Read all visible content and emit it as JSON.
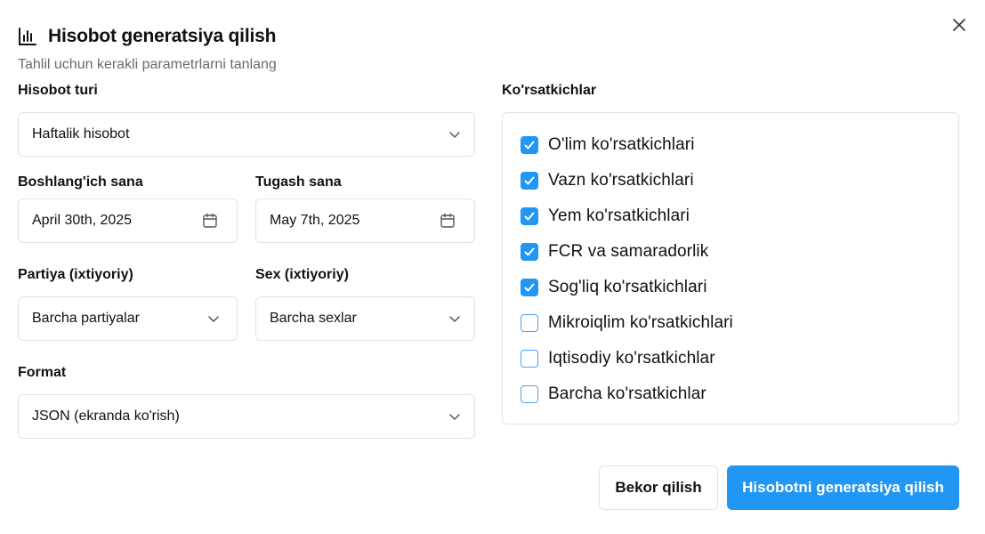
{
  "dialog": {
    "title": "Hisobot generatsiya qilish",
    "subtitle": "Tahlil uchun kerakli parametrlarni tanlang",
    "title_icon": "bar-chart-icon",
    "close_icon": "close-icon"
  },
  "form": {
    "report_type": {
      "label": "Hisobot turi",
      "value": "Haftalik hisobot"
    },
    "start_date": {
      "label": "Boshlang'ich sana",
      "value": "April 30th, 2025"
    },
    "end_date": {
      "label": "Tugash sana",
      "value": "May 7th, 2025"
    },
    "batch": {
      "label": "Partiya (ixtiyoriy)",
      "value": "Barcha partiyalar"
    },
    "sex": {
      "label": "Sex (ixtiyoriy)",
      "value": "Barcha sexlar"
    },
    "format": {
      "label": "Format",
      "value": "JSON (ekranda ko'rish)"
    }
  },
  "indicators": {
    "label": "Ko'rsatkichlar",
    "items": [
      {
        "label": "O'lim ko'rsatkichlari",
        "checked": true
      },
      {
        "label": "Vazn ko'rsatkichlari",
        "checked": true
      },
      {
        "label": "Yem ko'rsatkichlari",
        "checked": true
      },
      {
        "label": "FCR va samaradorlik",
        "checked": true
      },
      {
        "label": "Sog'liq ko'rsatkichlari",
        "checked": true
      },
      {
        "label": "Mikroiqlim ko'rsatkichlari",
        "checked": false
      },
      {
        "label": "Iqtisodiy ko'rsatkichlar",
        "checked": false
      },
      {
        "label": "Barcha ko'rsatkichlar",
        "checked": false
      }
    ]
  },
  "actions": {
    "cancel_label": "Bekor qilish",
    "submit_label": "Hisobotni generatsiya qilish"
  },
  "colors": {
    "accent": "#2196f3",
    "border": "#e2e2e2",
    "muted_text": "#6b6b6b"
  }
}
